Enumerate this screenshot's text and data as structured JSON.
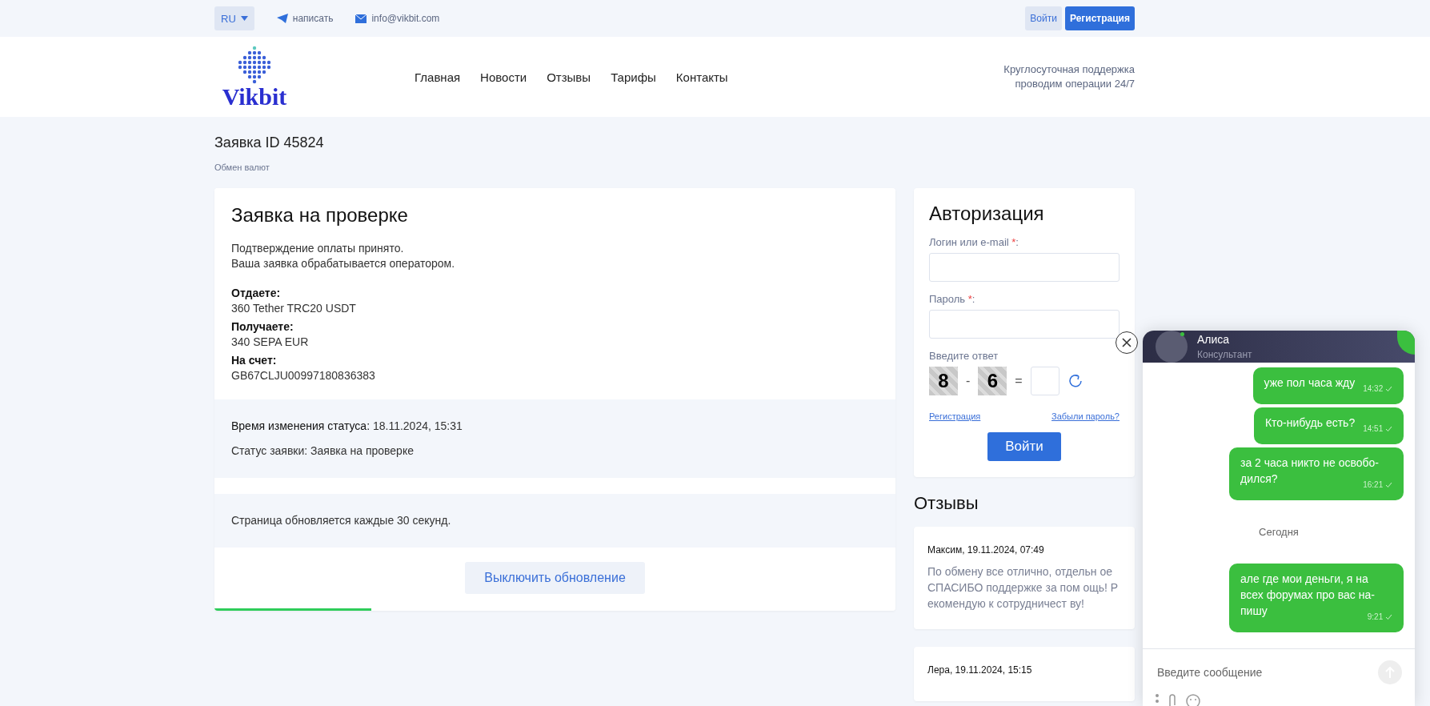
{
  "topbar": {
    "language": "RU",
    "contacts": [
      {
        "kind": "telegram",
        "label": "написать"
      },
      {
        "kind": "email",
        "label": "info@vikbit.com"
      }
    ],
    "login": "Войти",
    "register": "Регистрация"
  },
  "header": {
    "logo": "Vikbit",
    "nav": [
      "Главная",
      "Новости",
      "Отзывы",
      "Тарифы",
      "Контакты"
    ],
    "support": [
      "Круглосуточная поддержка",
      "проводим операции 24/7"
    ]
  },
  "page": {
    "title": "Заявка ID 45824",
    "breadcrumb": "Обмен валют"
  },
  "order": {
    "title": "Заявка на проверке",
    "message": [
      "Подтверждение оплаты принято.",
      "Ваша заявка обрабатывается оператором."
    ],
    "fields": [
      {
        "label": "Отдаете:",
        "value": "360 Tether TRC20 USDT"
      },
      {
        "label": "Получаете:",
        "value": "340 SEPA EUR"
      },
      {
        "label": "На счет:",
        "value": "GB67CLJU00997180836383"
      }
    ],
    "status_time_label": "Время изменения статуса:",
    "status_time": "18.11.2024, 15:31",
    "status_label": "Статус заявки:",
    "status": "Заявка на проверке",
    "refresh_note": "Страница обновляется каждые 30 секунд.",
    "refresh_button": "Выключить обновление",
    "refresh_progress": {
      "level": 0.23
    }
  },
  "auth": {
    "title": "Авторизация",
    "login_label": "Логин или e-mail",
    "password_label": "Пароль",
    "required_mark": "*",
    "label_suffix": ":",
    "captcha_label": "Введите ответ",
    "captcha": [
      "8",
      "-",
      "6",
      "="
    ],
    "register_link": "Регистрация",
    "forgot_link": "Забыли пароль?",
    "submit": "Войти"
  },
  "reviews": {
    "title": "Отзывы",
    "items": [
      {
        "header": "Максим, 19.11.2024, 07:49",
        "text": "По обмену все отлично, отдельн ое СПАСИБО поддержке за пом ощь! Рекомендую к сотрудничест ву!"
      },
      {
        "header": "Лера, 19.11.2024, 15:15"
      }
    ]
  },
  "chat": {
    "name": "Алиса",
    "role": "Консультант",
    "online": true,
    "messages": [
      {
        "kind": "message",
        "text": "уже пол часа жду",
        "time": "14:32"
      },
      {
        "kind": "message",
        "text": "Кто-нибудь есть?",
        "time": "14:51"
      },
      {
        "kind": "message",
        "text": "за 2 часа никто не освобо-дился?",
        "time": "16:21"
      },
      {
        "kind": "date",
        "text": "Сегодня"
      },
      {
        "kind": "message",
        "text": "але где мои деньги, я на всех форумах про вас на-пишу",
        "time": "9:21"
      }
    ],
    "input_placeholder": "Введите сообщение"
  }
}
